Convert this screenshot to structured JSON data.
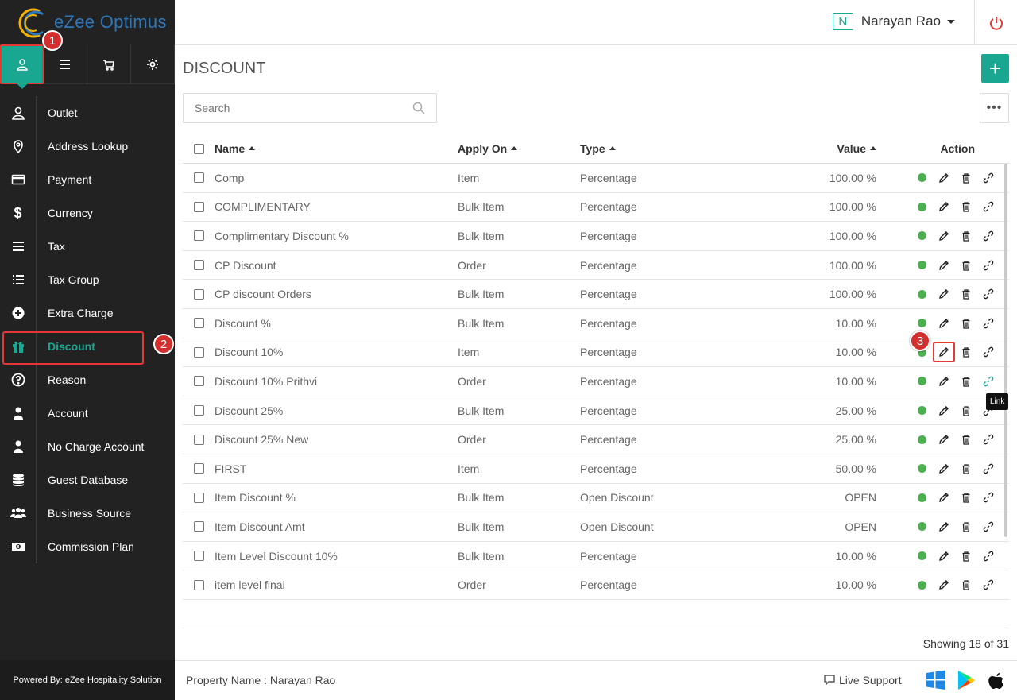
{
  "app": {
    "logo_text": "eZee Optimus"
  },
  "header": {
    "user_initial": "N",
    "user_name": "Narayan Rao"
  },
  "sidebar": {
    "top_icons": [
      "user-icon",
      "menu-icon",
      "cart-icon",
      "settings-icon"
    ],
    "items": [
      {
        "label": "Outlet"
      },
      {
        "label": "Address Lookup"
      },
      {
        "label": "Payment"
      },
      {
        "label": "Currency"
      },
      {
        "label": "Tax"
      },
      {
        "label": "Tax Group"
      },
      {
        "label": "Extra Charge"
      },
      {
        "label": "Discount"
      },
      {
        "label": "Reason"
      },
      {
        "label": "Account"
      },
      {
        "label": "No Charge Account"
      },
      {
        "label": "Guest Database"
      },
      {
        "label": "Business Source"
      },
      {
        "label": "Commission Plan"
      }
    ],
    "powered_by": "Powered By: eZee Hospitality Solution"
  },
  "badges": [
    "1",
    "2",
    "3"
  ],
  "page": {
    "title": "DISCOUNT",
    "search_placeholder": "Search",
    "add_label": "+",
    "more_label": "•••",
    "tooltip": "Link",
    "showing": "Showing 18 of 31"
  },
  "table": {
    "headers": {
      "name": "Name",
      "apply_on": "Apply On",
      "type": "Type",
      "value": "Value",
      "action": "Action"
    },
    "rows": [
      {
        "name": "Comp",
        "apply_on": "Item",
        "type": "Percentage",
        "value": "100.00 %"
      },
      {
        "name": "COMPLIMENTARY",
        "apply_on": "Bulk Item",
        "type": "Percentage",
        "value": "100.00 %"
      },
      {
        "name": "Complimentary Discount %",
        "apply_on": "Bulk Item",
        "type": "Percentage",
        "value": "100.00 %"
      },
      {
        "name": "CP Discount",
        "apply_on": "Order",
        "type": "Percentage",
        "value": "100.00 %"
      },
      {
        "name": "CP discount Orders",
        "apply_on": "Bulk Item",
        "type": "Percentage",
        "value": "100.00 %"
      },
      {
        "name": "Discount %",
        "apply_on": "Bulk Item",
        "type": "Percentage",
        "value": "10.00 %"
      },
      {
        "name": "Discount 10%",
        "apply_on": "Item",
        "type": "Percentage",
        "value": "10.00 %"
      },
      {
        "name": "Discount 10% Prithvi",
        "apply_on": "Order",
        "type": "Percentage",
        "value": "10.00 %"
      },
      {
        "name": "Discount 25%",
        "apply_on": "Bulk Item",
        "type": "Percentage",
        "value": "25.00 %"
      },
      {
        "name": "Discount 25% New",
        "apply_on": "Order",
        "type": "Percentage",
        "value": "25.00 %"
      },
      {
        "name": "FIRST",
        "apply_on": "Item",
        "type": "Percentage",
        "value": "50.00 %"
      },
      {
        "name": "Item Discount %",
        "apply_on": "Bulk Item",
        "type": "Open Discount",
        "value": "OPEN"
      },
      {
        "name": "Item Discount Amt",
        "apply_on": "Bulk Item",
        "type": "Open Discount",
        "value": "OPEN"
      },
      {
        "name": "Item Level Discount 10%",
        "apply_on": "Bulk Item",
        "type": "Percentage",
        "value": "10.00 %"
      },
      {
        "name": "item level final",
        "apply_on": "Order",
        "type": "Percentage",
        "value": "10.00 %"
      }
    ]
  },
  "footer": {
    "property": "Property Name : Narayan Rao",
    "live_support": "Live Support"
  },
  "colors": {
    "accent": "#1aa791",
    "highlight": "#e53935",
    "sidebar_bg": "#222222",
    "status_active": "#4caf50"
  }
}
